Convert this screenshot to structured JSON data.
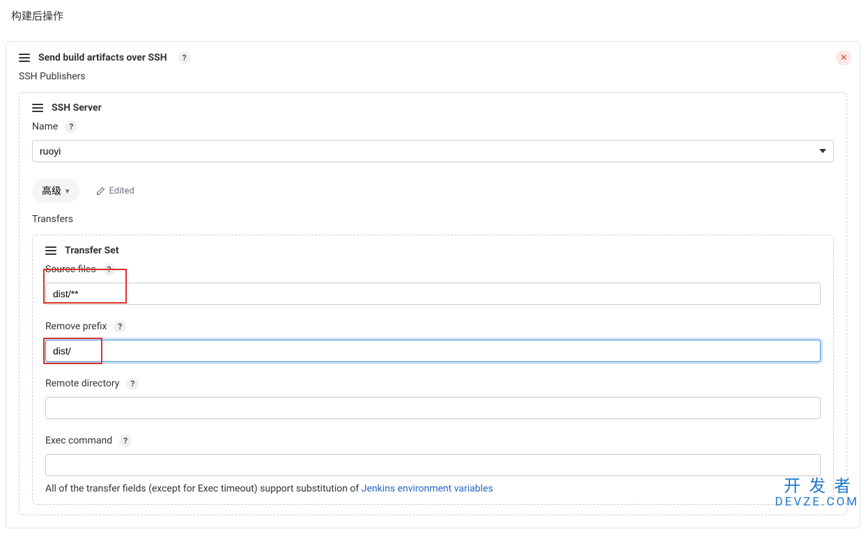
{
  "page_title": "构建后操作",
  "section_artifacts": {
    "title": "Send build artifacts over SSH",
    "help": "?",
    "publishers_label": "SSH Publishers"
  },
  "ssh_server": {
    "title": "SSH Server",
    "name_label": "Name",
    "name_help": "?",
    "name_value": "ruoyi",
    "advanced_label": "高级",
    "edited_label": "Edited",
    "transfers_label": "Transfers"
  },
  "transfer_set": {
    "title": "Transfer Set",
    "source_files_label": "Source files",
    "source_files_help": "?",
    "source_files_value": "dist/**",
    "remove_prefix_label": "Remove prefix",
    "remove_prefix_help": "?",
    "remove_prefix_value": "dist/",
    "remote_dir_label": "Remote directory",
    "remote_dir_help": "?",
    "remote_dir_value": "",
    "exec_label": "Exec command",
    "exec_help": "?",
    "exec_value": "",
    "footnote_prefix": "All of the transfer fields (except for Exec timeout) support substitution of ",
    "footnote_link": "Jenkins environment variables"
  },
  "watermark": {
    "cn": "开发者",
    "en": "DEVZE.COM"
  }
}
